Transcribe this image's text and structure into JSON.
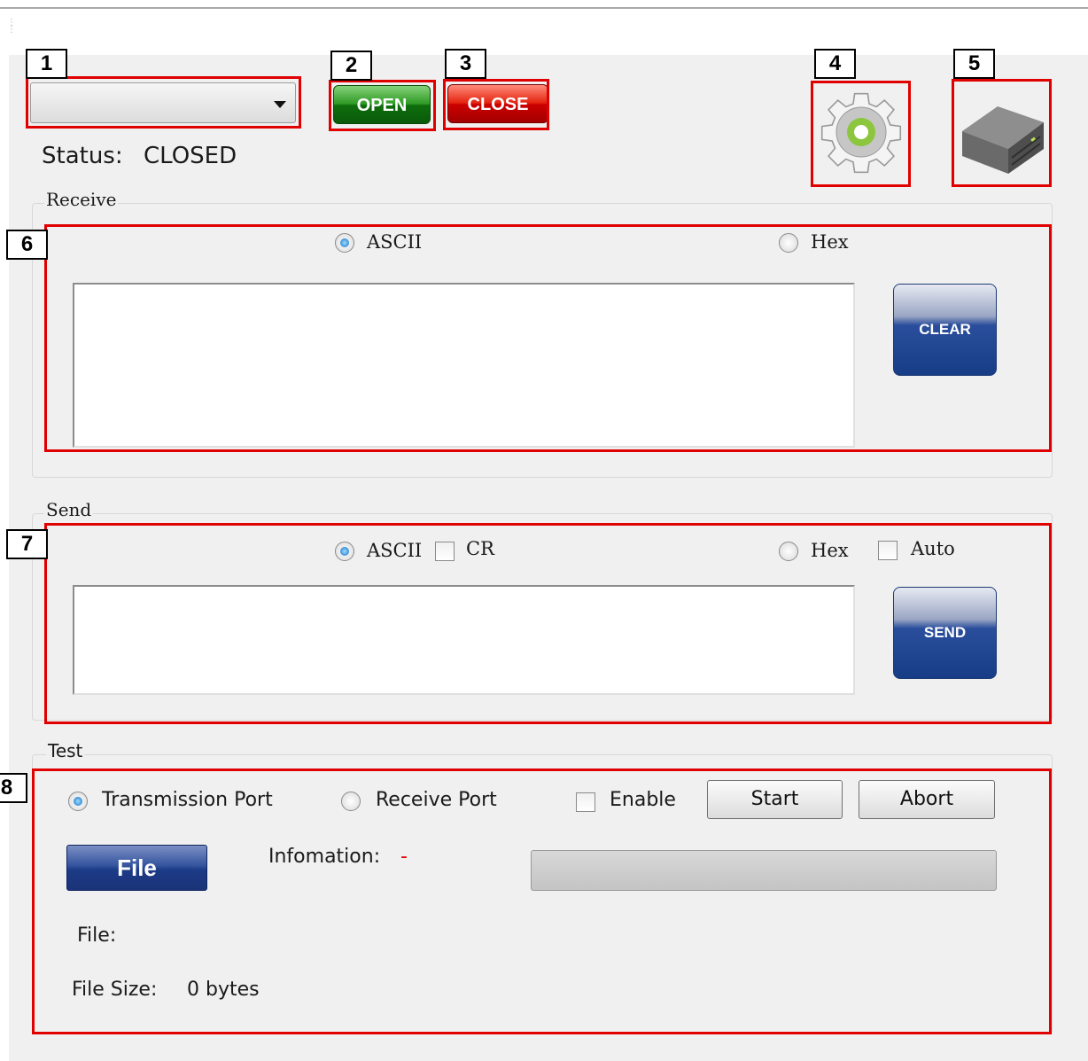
{
  "callouts": [
    "1",
    "2",
    "3",
    "4",
    "5",
    "6",
    "7",
    "8"
  ],
  "toolbar": {
    "port_select_value": "",
    "open_label": "OPEN",
    "close_label": "CLOSE",
    "settings_icon": "gear-icon",
    "device_icon": "device-box-icon"
  },
  "status": {
    "label": "Status:",
    "value": "CLOSED"
  },
  "receive": {
    "title": "Receive",
    "ascii_label": "ASCII",
    "ascii_selected": true,
    "hex_label": "Hex",
    "text_value": "",
    "clear_label": "CLEAR"
  },
  "send": {
    "title": "Send",
    "ascii_label": "ASCII",
    "cr_label": "CR",
    "hex_label": "Hex",
    "auto_label": "Auto",
    "text_value": "",
    "send_label": "SEND"
  },
  "test": {
    "title": "Test",
    "transmission_label": "Transmission Port",
    "receive_port_label": "Receive Port",
    "enable_label": "Enable",
    "start_label": "Start",
    "abort_label": "Abort",
    "file_button_label": "File",
    "info_label": "Infomation:",
    "info_value": "-",
    "file_label": "File:",
    "file_value": "",
    "size_label": "File Size:",
    "size_value": "0 bytes",
    "progress": 0
  },
  "colors": {
    "callout_red": "#e00000",
    "open_green": "#2f9a26",
    "close_red": "#e42410",
    "action_blue": "#173d86",
    "info_dash_red": "#e00000"
  }
}
